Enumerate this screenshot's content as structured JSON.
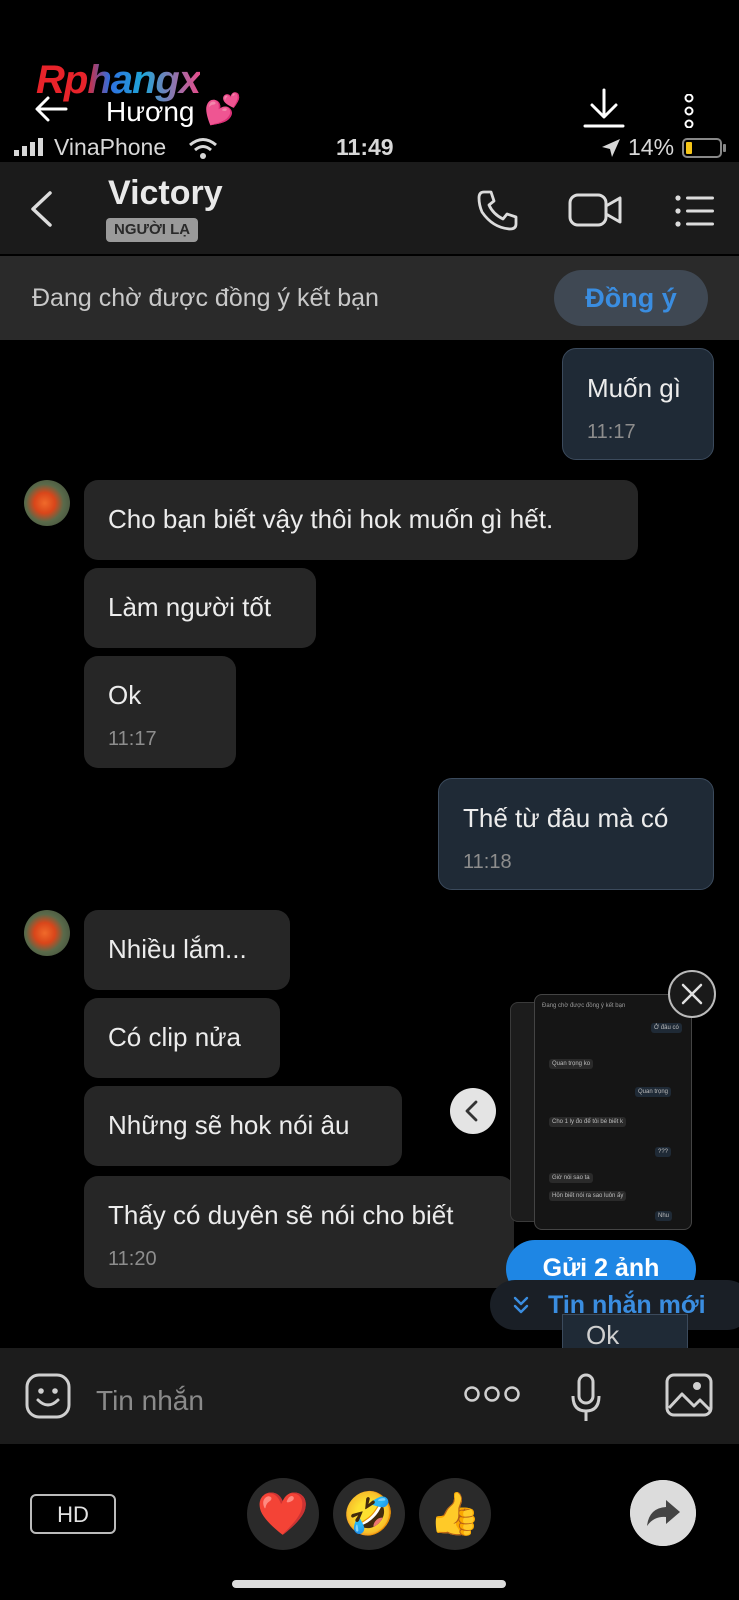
{
  "overlay": {
    "logo_text": "Rphangx",
    "subtitle": "Hương",
    "heart_glyph": "💕"
  },
  "status_bar": {
    "carrier": "VinaPhone",
    "time": "11:49",
    "battery": "14%"
  },
  "header": {
    "contact_name": "Victory",
    "badge": "NGƯỜI LẠ"
  },
  "pending": {
    "text": "Đang chờ được đồng ý kết bạn",
    "accept_label": "Đồng ý"
  },
  "messages": [
    {
      "side": "out",
      "text": "Muốn gì",
      "time": "11:17"
    },
    {
      "side": "in",
      "text": "Cho bạn biết vậy thôi hok muốn gì hết.",
      "time": ""
    },
    {
      "side": "in",
      "text": "Làm người tốt",
      "time": ""
    },
    {
      "side": "in",
      "text": "Ok",
      "time": "11:17"
    },
    {
      "side": "out",
      "text": "Thế từ đâu mà có",
      "time": "11:18"
    },
    {
      "side": "in",
      "text": "Nhiều lắm...",
      "time": ""
    },
    {
      "side": "in",
      "text": "Có clip nửa",
      "time": ""
    },
    {
      "side": "in",
      "text": "Những sẽ hok nói âu",
      "time": ""
    },
    {
      "side": "in",
      "text": "Thấy có duyên sẽ nói cho biết",
      "time": "11:20"
    }
  ],
  "preview": {
    "send_label": "Gửi 2 ảnh",
    "new_messages_label": "Tin nhắn mới",
    "peek_text": "Ok",
    "mini_header": "Đang chờ được đồng ý kết bạn",
    "mini_messages": [
      {
        "side": "out",
        "text": "Ở đâu có"
      },
      {
        "side": "in",
        "text": "Quan trọng ko"
      },
      {
        "side": "out",
        "text": "Quan trọng"
      },
      {
        "side": "in",
        "text": "Cho 1 ly đo để tôi bé biết k"
      },
      {
        "side": "out",
        "text": "???"
      },
      {
        "side": "in",
        "text": "Giờ nói sao ta"
      },
      {
        "side": "in",
        "text": "Hỏn biết nói ra sao luôn ấy"
      },
      {
        "side": "out",
        "text": "Nhu"
      }
    ]
  },
  "input": {
    "placeholder": "Tin nhắn"
  },
  "share_bar": {
    "hd_label": "HD",
    "reactions": [
      "❤️",
      "🤣",
      "👍"
    ]
  },
  "colors": {
    "accent": "#1e86e4",
    "accept_text": "#3a8de0",
    "outgoing_bubble": "#1f2a36",
    "incoming_bubble": "#262626"
  }
}
